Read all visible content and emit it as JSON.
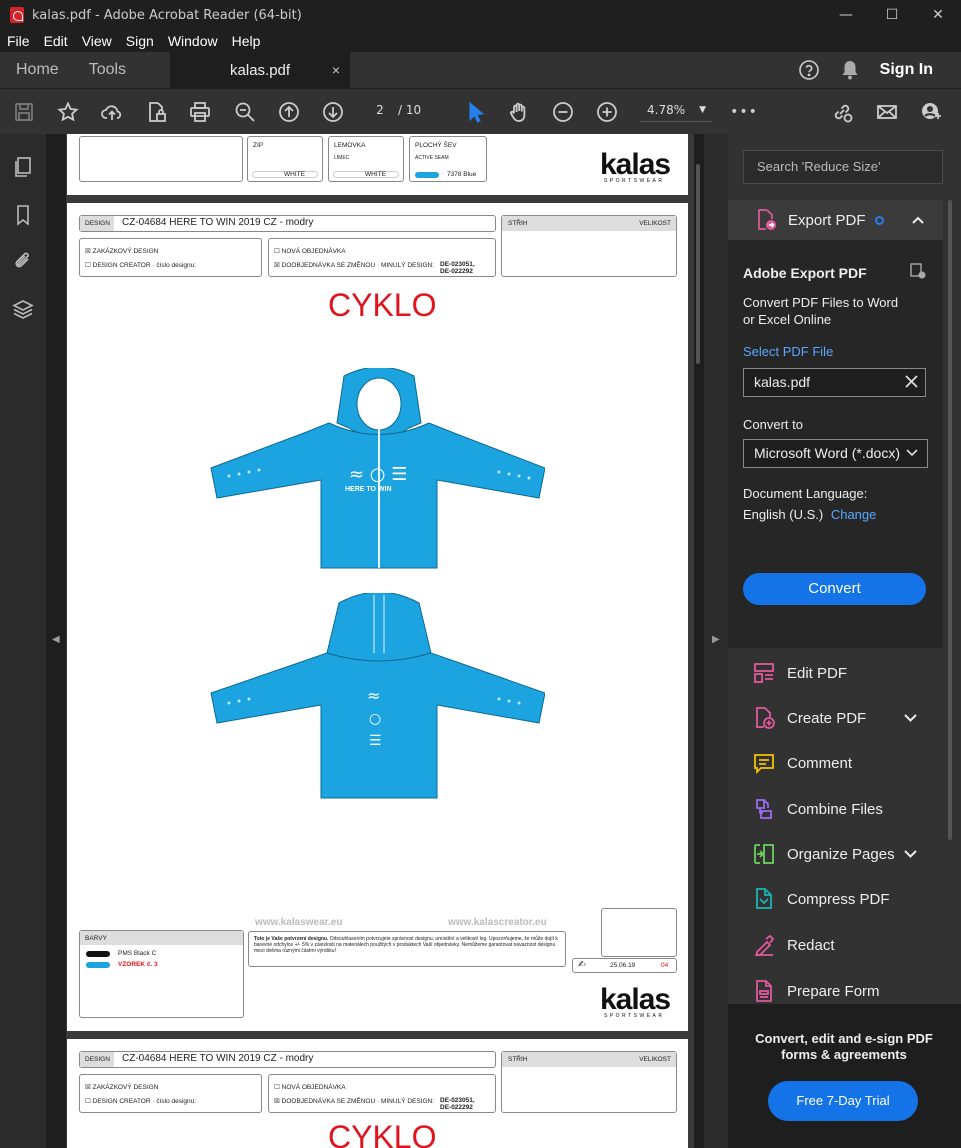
{
  "window": {
    "title": "kalas.pdf - Adobe Acrobat Reader (64-bit)",
    "minimize": "—",
    "maximize": "☐",
    "close": "✕"
  },
  "menu": [
    "File",
    "Edit",
    "View",
    "Sign",
    "Window",
    "Help"
  ],
  "tabs": {
    "home": "Home",
    "tools": "Tools",
    "document": "kalas.pdf",
    "close": "×",
    "sign_in": "Sign In"
  },
  "toolbar": {
    "page_current": "2",
    "page_total": "/ 10",
    "zoom": "4.78%",
    "more": "•••"
  },
  "document": {
    "page1_fragment": {
      "zip_label": "ZIP",
      "zip_value": "WHITE",
      "lemovka_label": "LEMOVKA",
      "lemovka_sub": "LÍMEC",
      "lemovka_value": "WHITE",
      "seam_label": "PLOCHÝ ŠEV",
      "seam_sub": "ACTIVE SEAM",
      "seam_value": "7378 Blue"
    },
    "page2": {
      "design_label": "DESIGN",
      "design_value": "CZ-04684 HERE TO WIN 2019 CZ - modry",
      "strih_label": "STŘIH",
      "velikost_label": "VELIKOST",
      "opt_custom": "ZAKÁZKOVÝ DESIGN",
      "opt_creator": "DESIGN CREATOR  ·  číslo designu:",
      "opt_new": "NOVÁ OBJEDNÁVKA",
      "opt_reorder": "DOOBJEDNÁVKA SE ZMĚNOU  ·  MINULÝ DESIGN:",
      "prev_design": "DE-023051,\nDE-022292",
      "title": "CYKLO",
      "barvy_label": "BARVY",
      "color1": "PMS Black C",
      "color2": "VZOREK č. 3",
      "web1": "www.kalaswear.eu",
      "web2": "www.kalascreator.eu",
      "note_bold": "Toto je Vaše potvrzení designu.",
      "note": " Odsouhlasením potvrzujete správnost designu, umístění a velikostí log. Upozorňujeme, že může dojít k barevné odchylce +/- 5% v závislosti na materiálech použitých v produktech Vaší objednávky. Nemůžeme garantovat návaznost designu mezi dvěma různými částmi výrobku!",
      "date": "25.06.19",
      "page_no": "04",
      "logo": "kalas",
      "logo_sub": "SPORTSWEAR",
      "garment_text": "HERE TO WIN"
    },
    "page3_fragment": {
      "design_label": "DESIGN",
      "design_value": "CZ-04684 HERE TO WIN 2019 CZ - modry",
      "title": "CYKLO"
    }
  },
  "right_panel": {
    "search_placeholder": "Search 'Reduce Size'",
    "export_pdf": "Export PDF",
    "export": {
      "heading": "Adobe Export PDF",
      "desc": "Convert PDF Files to Word or Excel Online",
      "select_label": "Select PDF File",
      "file": "kalas.pdf",
      "convert_to_label": "Convert to",
      "format": "Microsoft Word (*.docx)",
      "lang_label": "Document Language:",
      "lang": "English (U.S.)",
      "change": "Change",
      "convert_button": "Convert"
    },
    "tools": [
      "Edit PDF",
      "Create PDF",
      "Comment",
      "Combine Files",
      "Organize Pages",
      "Compress PDF",
      "Redact",
      "Prepare Form"
    ],
    "promo_text": "Convert, edit and e-sign PDF forms & agreements",
    "trial_button": "Free 7-Day Trial"
  },
  "colors": {
    "accent": "#1473e6",
    "garment_blue": "#1ca4e0",
    "cyklo_red": "#e0141e",
    "edit": "#e05a9c",
    "comment": "#f3c100",
    "combine": "#9b6cf0",
    "organize": "#6bd15f",
    "compress": "#1bb4b4"
  }
}
